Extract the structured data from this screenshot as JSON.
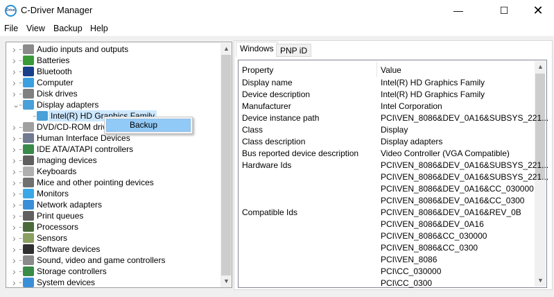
{
  "window": {
    "title": "C-Driver Manager",
    "logo_text": "Driver",
    "controls": [
      "minimize",
      "maximize",
      "close"
    ]
  },
  "menu": [
    "File",
    "View",
    "Backup",
    "Help"
  ],
  "tree": {
    "items": [
      {
        "label": "Audio inputs and outputs",
        "icon": "speaker-icon",
        "expanded": false
      },
      {
        "label": "Batteries",
        "icon": "battery-icon",
        "expanded": false
      },
      {
        "label": "Bluetooth",
        "icon": "bluetooth-icon",
        "expanded": false
      },
      {
        "label": "Computer",
        "icon": "computer-icon",
        "expanded": false
      },
      {
        "label": "Disk drives",
        "icon": "disk-drive-icon",
        "expanded": false
      },
      {
        "label": "Display adapters",
        "icon": "display-adapter-icon",
        "expanded": true
      },
      {
        "label": "Intel(R) HD Graphics Family",
        "icon": "display-adapter-icon",
        "child": true,
        "selected": true
      },
      {
        "label": "DVD/CD-ROM drives",
        "icon": "dvd-icon",
        "expanded": false
      },
      {
        "label": "Human Interface Devices",
        "icon": "hid-icon",
        "expanded": false
      },
      {
        "label": "IDE ATA/ATAPI controllers",
        "icon": "ide-controller-icon",
        "expanded": false
      },
      {
        "label": "Imaging devices",
        "icon": "camera-icon",
        "expanded": false
      },
      {
        "label": "Keyboards",
        "icon": "keyboard-icon",
        "expanded": false
      },
      {
        "label": "Mice and other pointing devices",
        "icon": "mouse-icon",
        "expanded": false
      },
      {
        "label": "Monitors",
        "icon": "monitor-icon",
        "expanded": false
      },
      {
        "label": "Network adapters",
        "icon": "network-icon",
        "expanded": false
      },
      {
        "label": "Print queues",
        "icon": "printer-icon",
        "expanded": false
      },
      {
        "label": "Processors",
        "icon": "processor-icon",
        "expanded": false
      },
      {
        "label": "Sensors",
        "icon": "sensor-icon",
        "expanded": false
      },
      {
        "label": "Software devices",
        "icon": "software-device-icon",
        "expanded": false
      },
      {
        "label": "Sound, video and game controllers",
        "icon": "speaker-icon",
        "expanded": false
      },
      {
        "label": "Storage controllers",
        "icon": "storage-controller-icon",
        "expanded": false
      },
      {
        "label": "System devices",
        "icon": "system-device-icon",
        "expanded": false
      }
    ]
  },
  "context_menu": {
    "items": [
      "Backup"
    ]
  },
  "tabs": [
    {
      "label": "Windows",
      "active": true
    },
    {
      "label": "PNP iD",
      "active": false
    }
  ],
  "properties": {
    "columns": [
      "Property",
      "Value"
    ],
    "rows": [
      [
        "Display name",
        "Intel(R) HD Graphics Family"
      ],
      [
        "Device description",
        "Intel(R) HD Graphics Family"
      ],
      [
        "Manufacturer",
        "Intel Corporation"
      ],
      [
        "Device instance path",
        "PCI\\VEN_8086&DEV_0A16&SUBSYS_221..."
      ],
      [
        "Class",
        "Display"
      ],
      [
        "Class description",
        "Display adapters"
      ],
      [
        "Bus reported device description",
        "Video Controller (VGA Compatible)"
      ],
      [
        "Hardware Ids",
        "PCI\\VEN_8086&DEV_0A16&SUBSYS_221..."
      ],
      [
        "",
        "PCI\\VEN_8086&DEV_0A16&SUBSYS_221..."
      ],
      [
        "",
        "PCI\\VEN_8086&DEV_0A16&CC_030000"
      ],
      [
        "",
        "PCI\\VEN_8086&DEV_0A16&CC_0300"
      ],
      [
        "Compatible Ids",
        "PCI\\VEN_8086&DEV_0A16&REV_0B"
      ],
      [
        "",
        "PCI\\VEN_8086&DEV_0A16"
      ],
      [
        "",
        "PCI\\VEN_8086&CC_030000"
      ],
      [
        "",
        "PCI\\VEN_8086&CC_0300"
      ],
      [
        "",
        "PCI\\VEN_8086"
      ],
      [
        "",
        "PCI\\CC_030000"
      ],
      [
        "",
        "PCI\\CC_0300"
      ]
    ]
  },
  "colors": {
    "selection": "#cce8ff",
    "context_highlight": "#91c9f7"
  }
}
